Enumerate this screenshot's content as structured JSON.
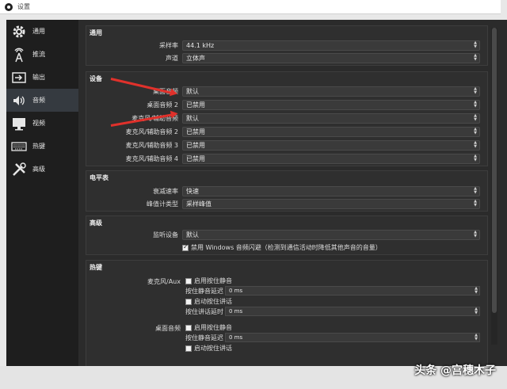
{
  "window": {
    "title": "设置"
  },
  "sidebar": {
    "items": [
      {
        "label": "通用",
        "icon": "gear-icon"
      },
      {
        "label": "推流",
        "icon": "antenna-icon"
      },
      {
        "label": "输出",
        "icon": "output-icon"
      },
      {
        "label": "音频",
        "icon": "speaker-icon",
        "active": true
      },
      {
        "label": "视频",
        "icon": "monitor-icon"
      },
      {
        "label": "热键",
        "icon": "keyboard-icon"
      },
      {
        "label": "高级",
        "icon": "tools-icon"
      }
    ]
  },
  "general": {
    "title": "通用",
    "sample_rate_label": "采样率",
    "sample_rate_value": "44.1 kHz",
    "channels_label": "声道",
    "channels_value": "立体声"
  },
  "devices": {
    "title": "设备",
    "rows": [
      {
        "label": "桌面音频",
        "value": "默认"
      },
      {
        "label": "桌面音频 2",
        "value": "已禁用"
      },
      {
        "label": "麦克风/辅助音频",
        "value": "默认"
      },
      {
        "label": "麦克风/辅助音频 2",
        "value": "已禁用"
      },
      {
        "label": "麦克风/辅助音频 3",
        "value": "已禁用"
      },
      {
        "label": "麦克风/辅助音频 4",
        "value": "已禁用"
      }
    ]
  },
  "meters": {
    "title": "电平表",
    "decay_label": "衰减速率",
    "decay_value": "快速",
    "peak_label": "峰值计类型",
    "peak_value": "采样峰值"
  },
  "advanced": {
    "title": "高级",
    "monitor_label": "监听设备",
    "monitor_value": "默认",
    "ducking_label": "禁用 Windows 音频闪避（检测到通信活动时降低其他声音的音量）",
    "ducking_checked": true
  },
  "hotkeys": {
    "title": "热键",
    "mic_label": "麦克风/Aux",
    "mic_push_mute": "启用按住静音",
    "mic_push_mute_delay_label": "按住静音延迟",
    "mic_push_mute_delay_value": "0  ms",
    "mic_push_talk": "启动按住讲话",
    "mic_push_talk_delay_label": "按住讲话延时",
    "mic_push_talk_delay_value": "0  ms",
    "desktop_label": "桌面音频",
    "desktop_push_mute": "启用按住静音",
    "desktop_push_mute_delay_label": "按住静音延迟",
    "desktop_push_mute_delay_value": "0  ms",
    "desktop_push_talk": "启动按住讲话"
  },
  "watermark": "头条 @宫穗木子",
  "colors": {
    "arrow": "#e0312b",
    "panel": "#2f2f2f",
    "sidebar": "#1e1e1e"
  }
}
